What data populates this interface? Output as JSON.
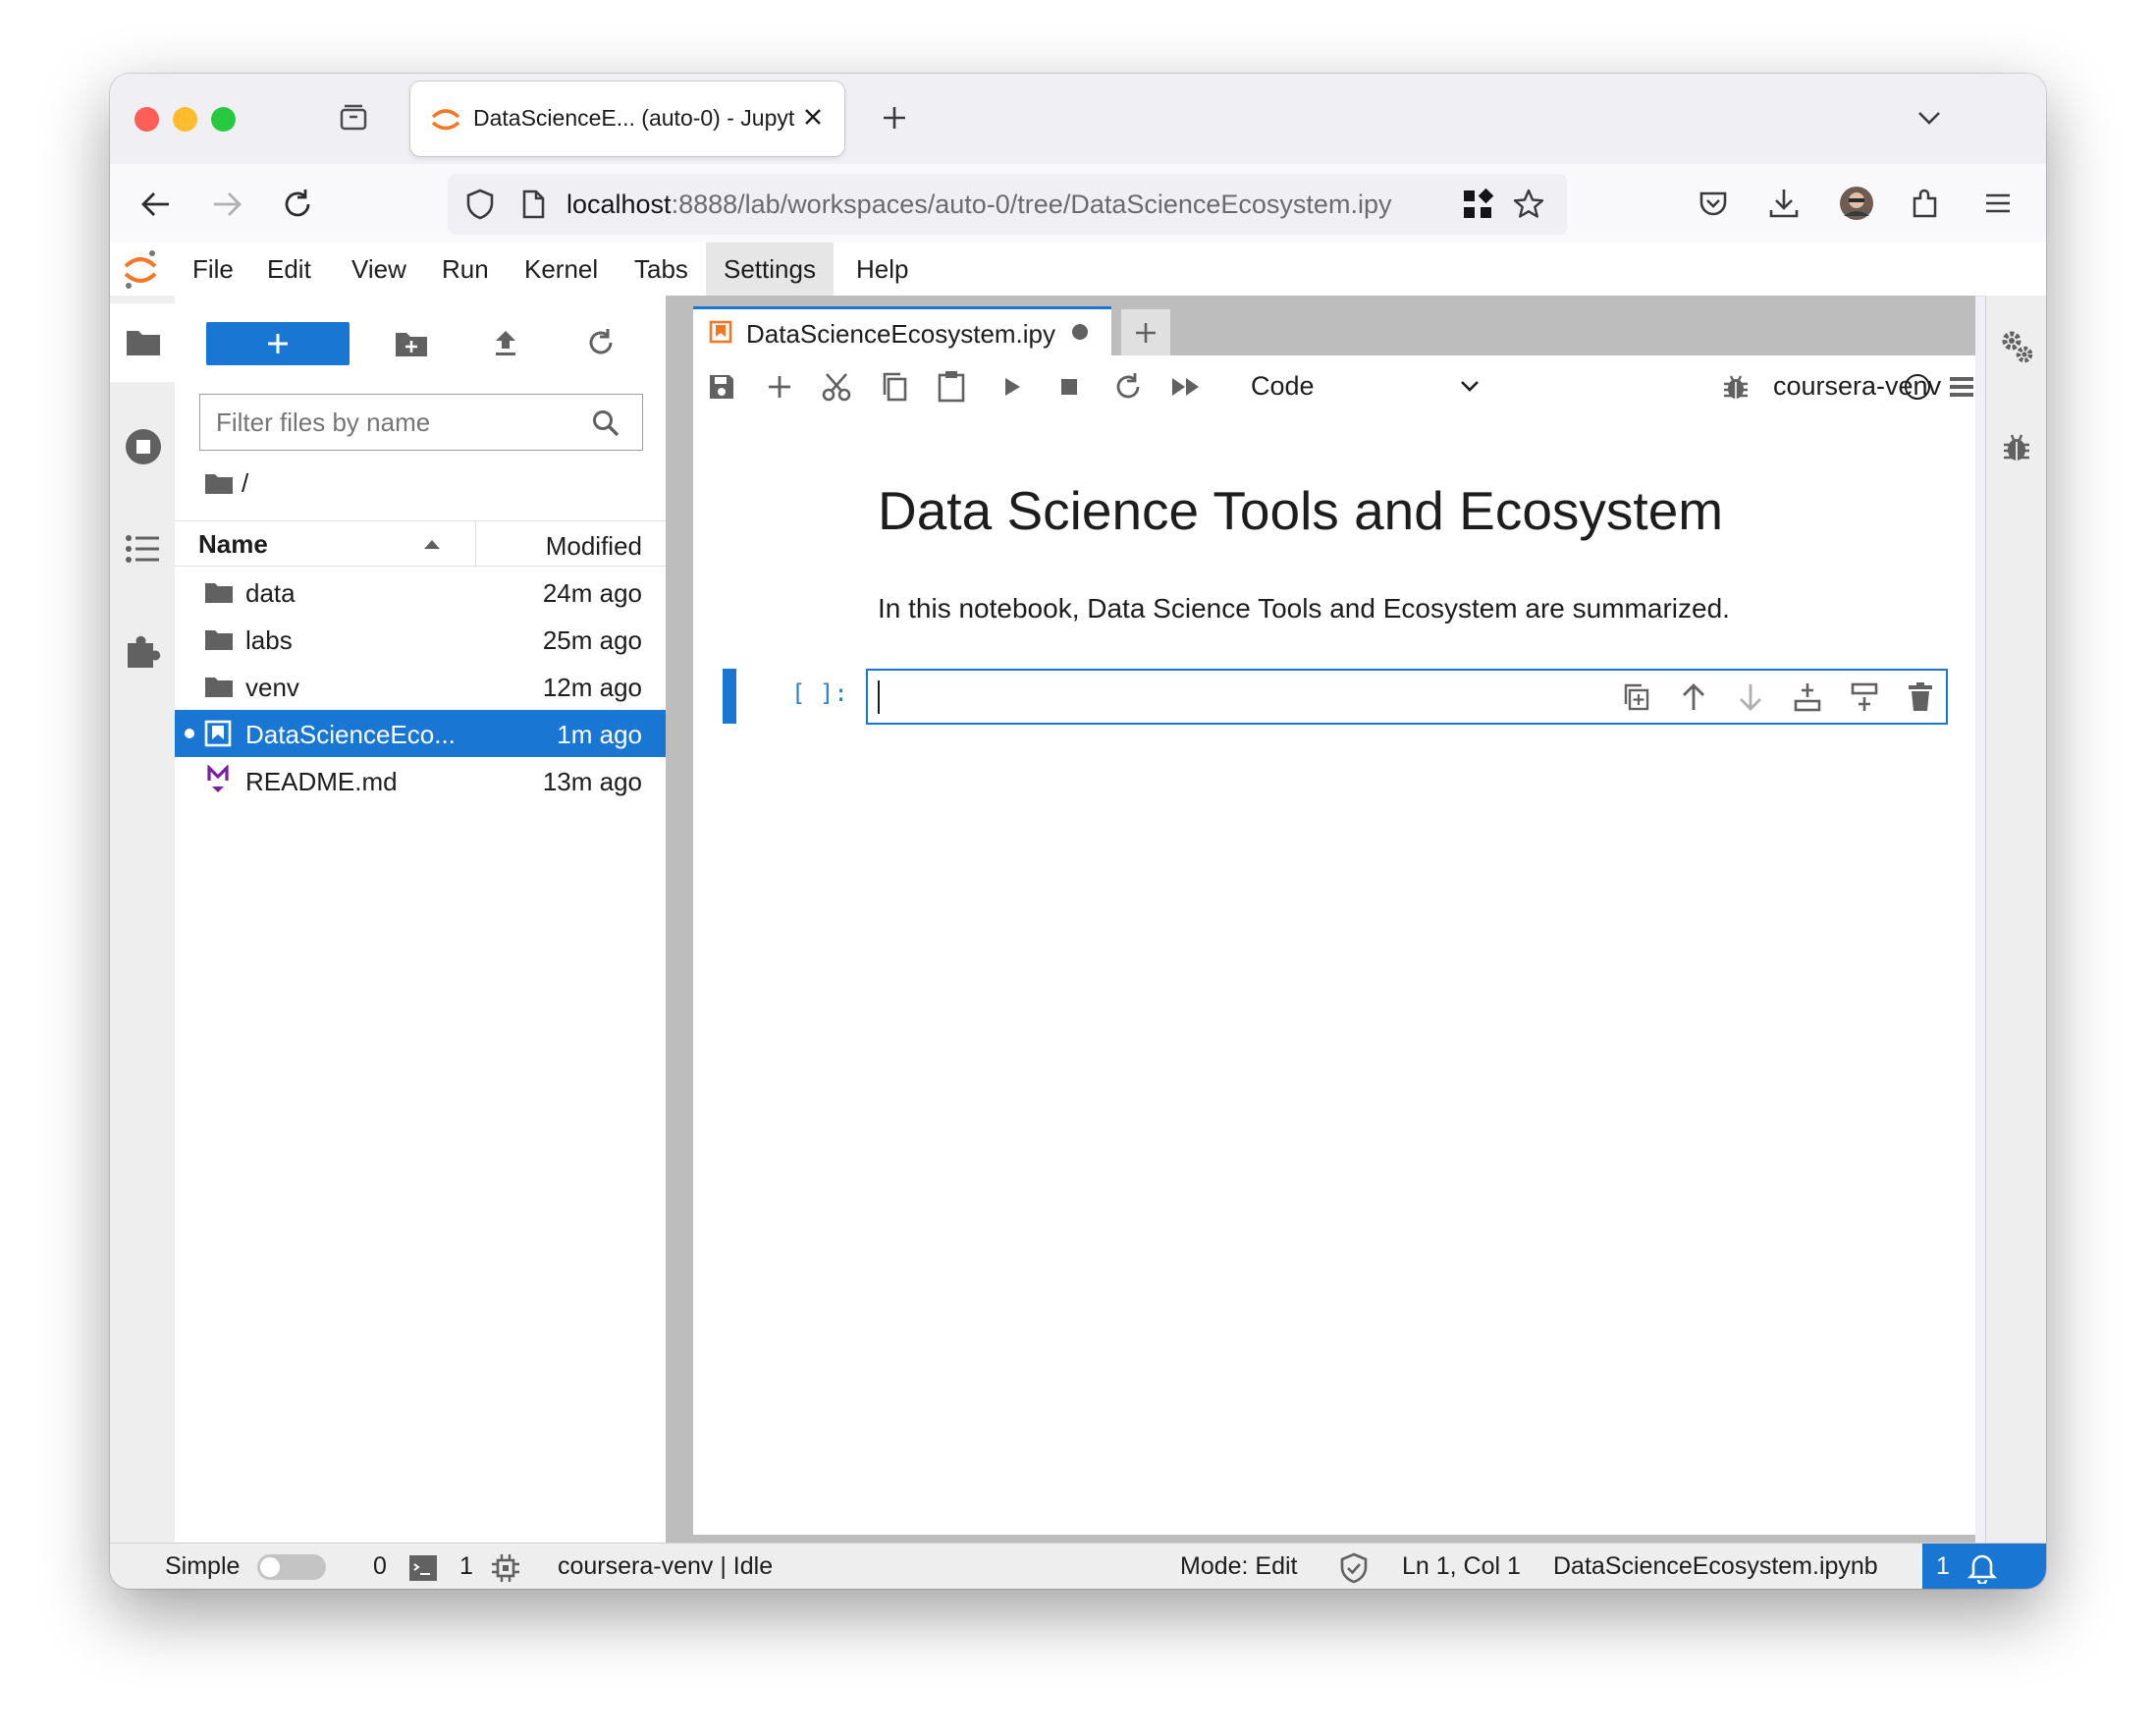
{
  "browser": {
    "tab_title": "DataScienceE... (auto-0) - Jupyt",
    "url_host": "localhost",
    "url_path": ":8888/lab/workspaces/auto-0/tree/DataScienceEcosystem.ipy"
  },
  "menu": {
    "items": [
      "File",
      "Edit",
      "View",
      "Run",
      "Kernel",
      "Tabs",
      "Settings",
      "Help"
    ],
    "active": "Settings"
  },
  "filebrowser": {
    "filter_placeholder": "Filter files by name",
    "breadcrumb": "/",
    "col_name": "Name",
    "col_modified": "Modified",
    "files": [
      {
        "name": "data",
        "modified": "24m ago",
        "kind": "folder-icon"
      },
      {
        "name": "labs",
        "modified": "25m ago",
        "kind": "folder-icon"
      },
      {
        "name": "venv",
        "modified": "12m ago",
        "kind": "folder-icon"
      },
      {
        "name": "DataScienceEco...",
        "modified": "1m ago",
        "kind": "notebook-icon",
        "selected": true
      },
      {
        "name": "README.md",
        "modified": "13m ago",
        "kind": "markdown-icon"
      }
    ]
  },
  "notebook": {
    "tab_title": "DataScienceEcosystem.ipy",
    "cell_type": "Code",
    "kernel": "coursera-venv",
    "heading": "Data Science Tools and Ecosystem",
    "paragraph": "In this notebook, Data Science Tools and Ecosystem are summarized.",
    "prompt": "[ ]:"
  },
  "status": {
    "mode_label": "Simple",
    "terminals": "0",
    "kernels": "1",
    "kernel_status": "coursera-venv | Idle",
    "mode": "Mode: Edit",
    "position": "Ln 1, Col 1",
    "filename": "DataScienceEcosystem.ipynb",
    "notifications": "1"
  },
  "colors": {
    "accent": "#1976d2",
    "jupyter_orange": "#f37726",
    "markdown_purple": "#7b1fa2"
  }
}
